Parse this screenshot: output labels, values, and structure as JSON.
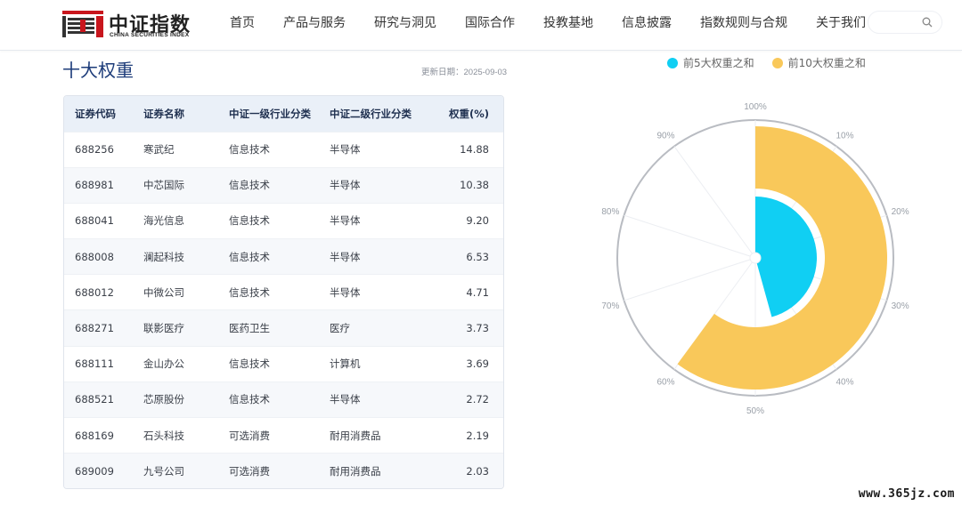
{
  "header": {
    "logo_cn": "中证指数",
    "logo_en": "CHINA SECURITIES INDEX",
    "nav": [
      "首页",
      "产品与服务",
      "研究与洞见",
      "国际合作",
      "投教基地",
      "信息披露",
      "指数规则与合规",
      "关于我们"
    ],
    "search_icon": "search-icon"
  },
  "section": {
    "title": "十大权重",
    "update_date": "更新日期：2025-09-03"
  },
  "table": {
    "headers": [
      "证券代码",
      "证券名称",
      "中证一级行业分类",
      "中证二级行业分类",
      "权重(%)"
    ],
    "rows": [
      [
        "688256",
        "寒武纪",
        "信息技术",
        "半导体",
        "14.88"
      ],
      [
        "688981",
        "中芯国际",
        "信息技术",
        "半导体",
        "10.38"
      ],
      [
        "688041",
        "海光信息",
        "信息技术",
        "半导体",
        "9.20"
      ],
      [
        "688008",
        "澜起科技",
        "信息技术",
        "半导体",
        "6.53"
      ],
      [
        "688012",
        "中微公司",
        "信息技术",
        "半导体",
        "4.71"
      ],
      [
        "688271",
        "联影医疗",
        "医药卫生",
        "医疗",
        "3.73"
      ],
      [
        "688111",
        "金山办公",
        "信息技术",
        "计算机",
        "3.69"
      ],
      [
        "688521",
        "芯原股份",
        "信息技术",
        "半导体",
        "2.72"
      ],
      [
        "688169",
        "石头科技",
        "可选消费",
        "耐用消费品",
        "2.19"
      ],
      [
        "689009",
        "九号公司",
        "可选消费",
        "耐用消费品",
        "2.03"
      ]
    ]
  },
  "chart_data": {
    "type": "polar-bar",
    "legend": [
      {
        "name": "前5大权重之和",
        "color": "#10cff3"
      },
      {
        "name": "前10大权重之和",
        "color": "#f9c85a"
      }
    ],
    "series": [
      {
        "name": "前5大权重之和",
        "value": 45.7
      },
      {
        "name": "前10大权重之和",
        "value": 60.06
      }
    ],
    "angle_ticks": [
      "100%",
      "10%",
      "20%",
      "30%",
      "40%",
      "50%",
      "60%",
      "70%",
      "80%",
      "90%"
    ],
    "angle_range": [
      0,
      100
    ]
  },
  "watermark": "www.365jz.com"
}
